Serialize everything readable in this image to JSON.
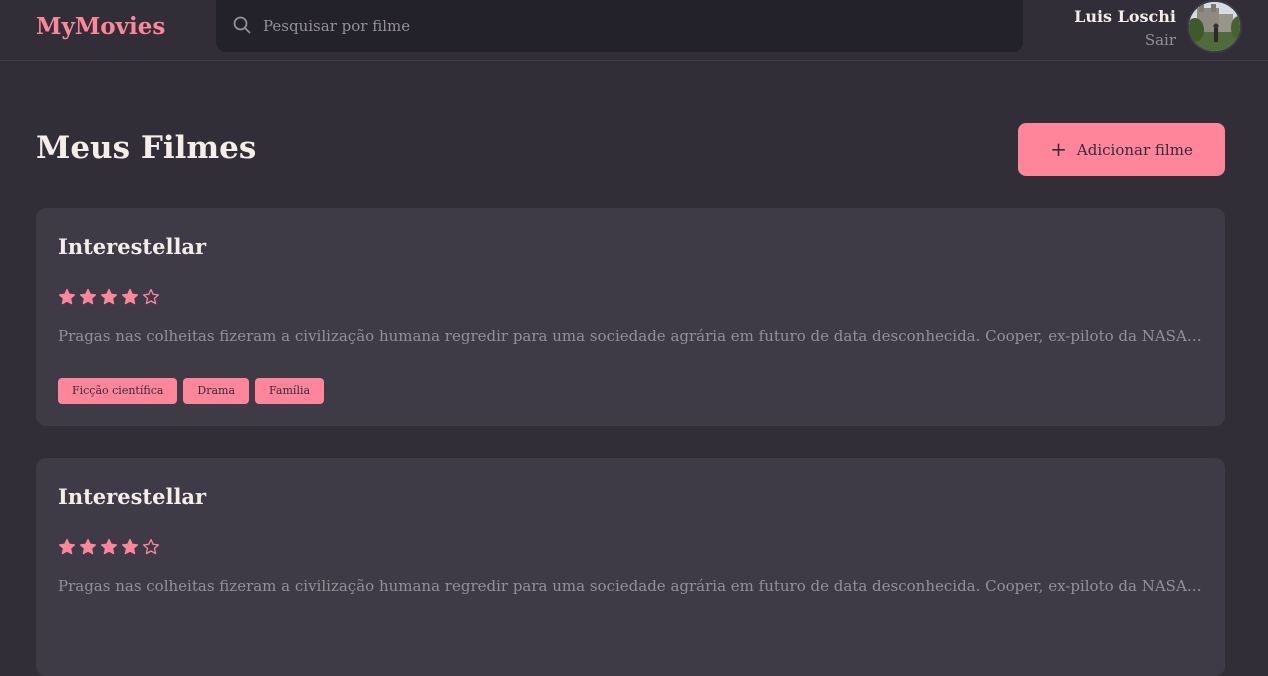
{
  "header": {
    "logo": "MyMovies",
    "search_placeholder": "Pesquisar por filme",
    "user_name": "Luis Loschi",
    "logout_label": "Sair"
  },
  "main": {
    "title": "Meus Filmes",
    "add_button_label": "Adicionar filme"
  },
  "colors": {
    "accent": "#ff859b",
    "background": "#312e38",
    "card": "#3e3b47",
    "input": "#232129",
    "muted_text": "#948f99"
  },
  "movies": [
    {
      "title": "Interestellar",
      "rating": 4,
      "max_rating": 5,
      "description": "Pragas nas colheitas fizeram a civilização humana regredir para uma sociedade agrária em futuro de data desconhecida. Cooper, ex-piloto da NASA, tem uma fazenda com sua família.",
      "tags": [
        "Ficção científica",
        "Drama",
        "Família"
      ]
    },
    {
      "title": "Interestellar",
      "rating": 4,
      "max_rating": 5,
      "description": "Pragas nas colheitas fizeram a civilização humana regredir para uma sociedade agrária em futuro de data desconhecida. Cooper, ex-piloto da NASA, tem uma fazenda com sua família.",
      "tags": []
    }
  ]
}
